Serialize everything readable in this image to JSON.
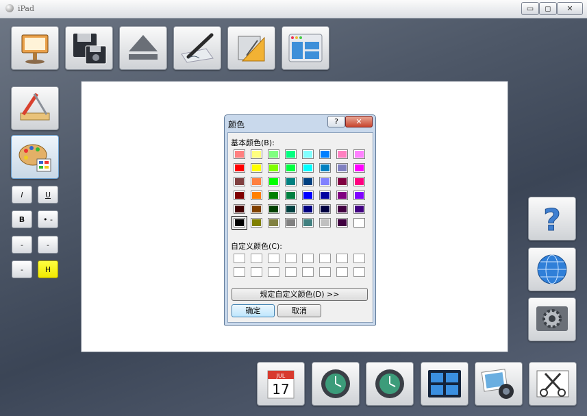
{
  "window": {
    "title": "iPad",
    "minimize": "▭",
    "restore": "◻",
    "close": "✕"
  },
  "toolbar": [
    "keynote-presentation-icon",
    "save-disk-icon",
    "eject-icon",
    "signature-pen-icon",
    "geometry-tools-icon",
    "window-layout-icon"
  ],
  "left_tools": [
    "pencil-ruler-icon",
    "palette-icon"
  ],
  "format": {
    "italic": "I",
    "underline": "U",
    "bold": "B",
    "dot": "• -",
    "b1": "-",
    "b2": "-",
    "b3": "-",
    "highlight": "H"
  },
  "right_tools": [
    "help-icon",
    "network-globe-icon",
    "system-preferences-icon"
  ],
  "dock": [
    "calendar-icon",
    "time-machine-icon",
    "time-machine-icon",
    "window-tiles-icon",
    "photo-camera-icon",
    "scissors-icon"
  ],
  "calendar": {
    "month": "JUL",
    "day": "17"
  },
  "dialog": {
    "title": "颜色",
    "help": "?",
    "close": "✕",
    "basic_colors_label": "基本颜色(B):",
    "custom_colors_label": "自定义颜色(C):",
    "define_custom_button": "规定自定义颜色(D) >>",
    "ok_button": "确定",
    "cancel_button": "取消",
    "basic_colors": [
      [
        "#FF8080",
        "#FFFF80",
        "#80FF80",
        "#00FF80",
        "#80FFFF",
        "#0080FF",
        "#FF80C0",
        "#FF80FF"
      ],
      [
        "#FF0000",
        "#FFFF00",
        "#80FF00",
        "#00FF40",
        "#00FFFF",
        "#0080C0",
        "#8080C0",
        "#FF00FF"
      ],
      [
        "#804040",
        "#FF8040",
        "#00FF00",
        "#008080",
        "#004080",
        "#8080FF",
        "#800040",
        "#FF0080"
      ],
      [
        "#800000",
        "#FF8000",
        "#008000",
        "#008040",
        "#0000FF",
        "#0000A0",
        "#800080",
        "#8000FF"
      ],
      [
        "#400000",
        "#804000",
        "#004000",
        "#004040",
        "#000080",
        "#000040",
        "#400040",
        "#400080"
      ],
      [
        "#000000",
        "#808000",
        "#808040",
        "#808080",
        "#408080",
        "#C0C0C0",
        "#400040",
        "#FFFFFF"
      ]
    ],
    "selected_color": "#000000"
  }
}
